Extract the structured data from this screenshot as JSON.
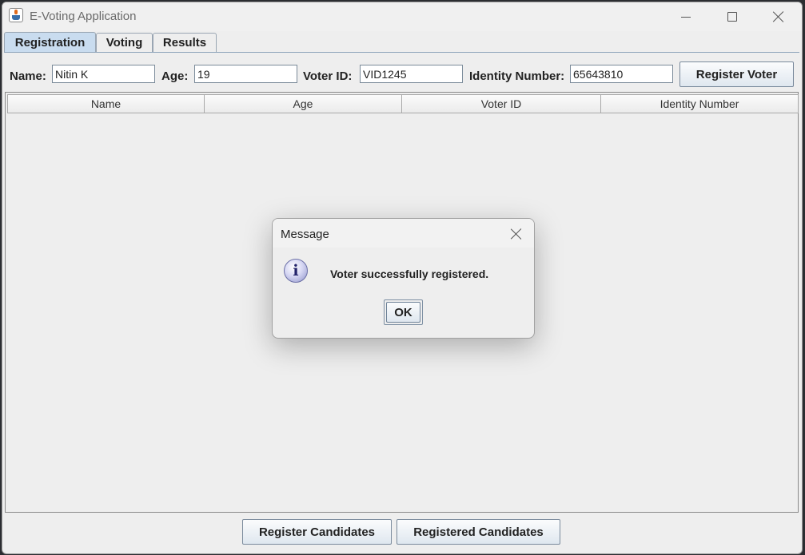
{
  "window": {
    "title": "E-Voting Application"
  },
  "tabs": [
    "Registration",
    "Voting",
    "Results"
  ],
  "form": {
    "name_label": "Name:",
    "name_value": "Nitin K",
    "age_label": "Age:",
    "age_value": "19",
    "voter_id_label": "Voter ID:",
    "voter_id_value": "VID1245",
    "identity_label": "Identity Number:",
    "identity_value": "65643810",
    "register_button": "Register Voter"
  },
  "table": {
    "columns": [
      "Name",
      "Age",
      "Voter ID",
      "Identity Number"
    ],
    "rows": []
  },
  "bottom_buttons": {
    "register_candidates": "Register Candidates",
    "registered_candidates": "Registered Candidates"
  },
  "dialog": {
    "title": "Message",
    "message": "Voter successfully registered.",
    "ok": "OK",
    "icon": "info-icon"
  },
  "colors": {
    "active_tab": "#c9dcef",
    "button_bottom": "#dfe7ef",
    "tab_border": "#8ea4bb"
  }
}
